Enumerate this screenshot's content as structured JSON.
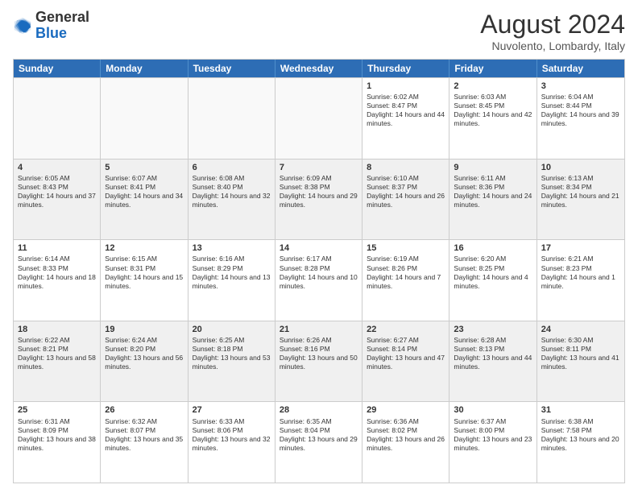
{
  "logo": {
    "line1": "General",
    "line2": "Blue"
  },
  "title": "August 2024",
  "location": "Nuvolento, Lombardy, Italy",
  "days": [
    "Sunday",
    "Monday",
    "Tuesday",
    "Wednesday",
    "Thursday",
    "Friday",
    "Saturday"
  ],
  "rows": [
    [
      {
        "date": "",
        "info": "",
        "empty": true
      },
      {
        "date": "",
        "info": "",
        "empty": true
      },
      {
        "date": "",
        "info": "",
        "empty": true
      },
      {
        "date": "",
        "info": "",
        "empty": true
      },
      {
        "date": "1",
        "info": "Sunrise: 6:02 AM\nSunset: 8:47 PM\nDaylight: 14 hours and 44 minutes.",
        "empty": false
      },
      {
        "date": "2",
        "info": "Sunrise: 6:03 AM\nSunset: 8:45 PM\nDaylight: 14 hours and 42 minutes.",
        "empty": false
      },
      {
        "date": "3",
        "info": "Sunrise: 6:04 AM\nSunset: 8:44 PM\nDaylight: 14 hours and 39 minutes.",
        "empty": false
      }
    ],
    [
      {
        "date": "4",
        "info": "Sunrise: 6:05 AM\nSunset: 8:43 PM\nDaylight: 14 hours and 37 minutes.",
        "empty": false
      },
      {
        "date": "5",
        "info": "Sunrise: 6:07 AM\nSunset: 8:41 PM\nDaylight: 14 hours and 34 minutes.",
        "empty": false
      },
      {
        "date": "6",
        "info": "Sunrise: 6:08 AM\nSunset: 8:40 PM\nDaylight: 14 hours and 32 minutes.",
        "empty": false
      },
      {
        "date": "7",
        "info": "Sunrise: 6:09 AM\nSunset: 8:38 PM\nDaylight: 14 hours and 29 minutes.",
        "empty": false
      },
      {
        "date": "8",
        "info": "Sunrise: 6:10 AM\nSunset: 8:37 PM\nDaylight: 14 hours and 26 minutes.",
        "empty": false
      },
      {
        "date": "9",
        "info": "Sunrise: 6:11 AM\nSunset: 8:36 PM\nDaylight: 14 hours and 24 minutes.",
        "empty": false
      },
      {
        "date": "10",
        "info": "Sunrise: 6:13 AM\nSunset: 8:34 PM\nDaylight: 14 hours and 21 minutes.",
        "empty": false
      }
    ],
    [
      {
        "date": "11",
        "info": "Sunrise: 6:14 AM\nSunset: 8:33 PM\nDaylight: 14 hours and 18 minutes.",
        "empty": false
      },
      {
        "date": "12",
        "info": "Sunrise: 6:15 AM\nSunset: 8:31 PM\nDaylight: 14 hours and 15 minutes.",
        "empty": false
      },
      {
        "date": "13",
        "info": "Sunrise: 6:16 AM\nSunset: 8:29 PM\nDaylight: 14 hours and 13 minutes.",
        "empty": false
      },
      {
        "date": "14",
        "info": "Sunrise: 6:17 AM\nSunset: 8:28 PM\nDaylight: 14 hours and 10 minutes.",
        "empty": false
      },
      {
        "date": "15",
        "info": "Sunrise: 6:19 AM\nSunset: 8:26 PM\nDaylight: 14 hours and 7 minutes.",
        "empty": false
      },
      {
        "date": "16",
        "info": "Sunrise: 6:20 AM\nSunset: 8:25 PM\nDaylight: 14 hours and 4 minutes.",
        "empty": false
      },
      {
        "date": "17",
        "info": "Sunrise: 6:21 AM\nSunset: 8:23 PM\nDaylight: 14 hours and 1 minute.",
        "empty": false
      }
    ],
    [
      {
        "date": "18",
        "info": "Sunrise: 6:22 AM\nSunset: 8:21 PM\nDaylight: 13 hours and 58 minutes.",
        "empty": false
      },
      {
        "date": "19",
        "info": "Sunrise: 6:24 AM\nSunset: 8:20 PM\nDaylight: 13 hours and 56 minutes.",
        "empty": false
      },
      {
        "date": "20",
        "info": "Sunrise: 6:25 AM\nSunset: 8:18 PM\nDaylight: 13 hours and 53 minutes.",
        "empty": false
      },
      {
        "date": "21",
        "info": "Sunrise: 6:26 AM\nSunset: 8:16 PM\nDaylight: 13 hours and 50 minutes.",
        "empty": false
      },
      {
        "date": "22",
        "info": "Sunrise: 6:27 AM\nSunset: 8:14 PM\nDaylight: 13 hours and 47 minutes.",
        "empty": false
      },
      {
        "date": "23",
        "info": "Sunrise: 6:28 AM\nSunset: 8:13 PM\nDaylight: 13 hours and 44 minutes.",
        "empty": false
      },
      {
        "date": "24",
        "info": "Sunrise: 6:30 AM\nSunset: 8:11 PM\nDaylight: 13 hours and 41 minutes.",
        "empty": false
      }
    ],
    [
      {
        "date": "25",
        "info": "Sunrise: 6:31 AM\nSunset: 8:09 PM\nDaylight: 13 hours and 38 minutes.",
        "empty": false
      },
      {
        "date": "26",
        "info": "Sunrise: 6:32 AM\nSunset: 8:07 PM\nDaylight: 13 hours and 35 minutes.",
        "empty": false
      },
      {
        "date": "27",
        "info": "Sunrise: 6:33 AM\nSunset: 8:06 PM\nDaylight: 13 hours and 32 minutes.",
        "empty": false
      },
      {
        "date": "28",
        "info": "Sunrise: 6:35 AM\nSunset: 8:04 PM\nDaylight: 13 hours and 29 minutes.",
        "empty": false
      },
      {
        "date": "29",
        "info": "Sunrise: 6:36 AM\nSunset: 8:02 PM\nDaylight: 13 hours and 26 minutes.",
        "empty": false
      },
      {
        "date": "30",
        "info": "Sunrise: 6:37 AM\nSunset: 8:00 PM\nDaylight: 13 hours and 23 minutes.",
        "empty": false
      },
      {
        "date": "31",
        "info": "Sunrise: 6:38 AM\nSunset: 7:58 PM\nDaylight: 13 hours and 20 minutes.",
        "empty": false
      }
    ]
  ]
}
